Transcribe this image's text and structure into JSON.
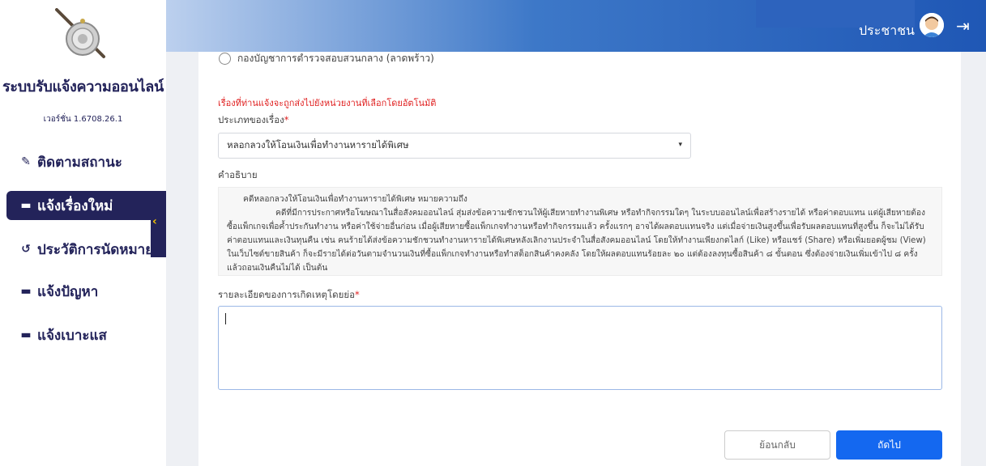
{
  "sidebar": {
    "title": "ระบบรับแจ้งความออนไลน์",
    "version": "เวอร์ชั่น 1.6708.26.1",
    "items": [
      {
        "label": "ติดตามสถานะ",
        "icon": "edit-icon"
      },
      {
        "label": "แจ้งเรื่องใหม่",
        "icon": "folder-plus-icon",
        "active": true
      },
      {
        "label": "ประวัติการนัดหมาย",
        "icon": "history-icon"
      },
      {
        "label": "แจ้งปัญหา",
        "icon": "folder-icon"
      },
      {
        "label": "แจ้งเบาะแส",
        "icon": "folder-plus-icon"
      }
    ]
  },
  "header": {
    "user_label": "ประชาชน"
  },
  "form": {
    "radio_option": "กองบัญชาการตำรวจสอบสวนกลาง (ลาดพร้าว)",
    "notice": "เรื่องที่ท่านแจ้งจะถูกส่งไปยังหน่วยงานที่เลือกโดยอัตโนมัติ",
    "category_label": "ประเภทของเรื่อง",
    "category_value": "หลอกลวงให้โอนเงินเพื่อทำงานหารายได้พิเศษ",
    "description_label": "คำอธิบาย",
    "description_title": "คดีหลอกลวงให้โอนเงินเพื่อทำงานหารายได้พิเศษ หมายความถึง",
    "description_text": "คดีที่มีการประกาศหรือโฆษณาในสื่อสังคมออนไลน์ สุ่มส่งข้อความชักชวนให้ผู้เสียหายทำงานพิเศษ หรือทำกิจกรรมใดๆ ในระบบออนไลน์เพื่อสร้างรายได้ หรือค่าตอบแทน แต่ผู้เสียหายต้องซื้อแพ็กเกจเพื่อค้ำประกันทำงาน หรือค่าใช้จ่ายอื่นก่อน เมื่อผู้เสียหายซื้อแพ็กเกจทำงานหรือทำกิจกรรมแล้ว ครั้งแรกๆ อาจได้ผลตอบแทนจริง แต่เมื่อจ่ายเงินสูงขึ้นเพื่อรับผลตอบแทนที่สูงขึ้น ก็จะไม่ได้รับค่าตอบแทนและเงินทุนคืน เช่น คนร้ายได้ส่งข้อความชักชวนทำงานหารายได้พิเศษหลังเลิกงานประจำในสื่อสังคมออนไลน์ โดยให้ทำงานเพียงกดไลก์ (Like) หรือแชร์ (Share) หรือเพิ่มยอดผู้ชม (View) ในเว็บไซต์ขายสินค้า ก็จะมีรายได้ต่อวันตามจำนวนเงินที่ซื้อแพ็กเกจทำงานหรือทำสต็อกสินค้าคงคลัง โดยให้ผลตอบแทนร้อยละ ๒๐ แต่ต้องลงทุนซื้อสินค้า ๘ ขั้นตอน ซึ่งต้องจ่ายเงินเพิ่มเข้าไป ๘ ครั้ง แล้วถอนเงินคืนไม่ได้ เป็นต้น",
    "details_label": "รายละเอียดของการเกิดเหตุโดยย่อ",
    "details_value": "",
    "required_mark": "*",
    "back_label": "ย้อนกลับ",
    "next_label": "ถัดไป"
  },
  "colors": {
    "sidebar_text": "#23235a",
    "primary": "#1468f0",
    "required": "#e02020"
  }
}
